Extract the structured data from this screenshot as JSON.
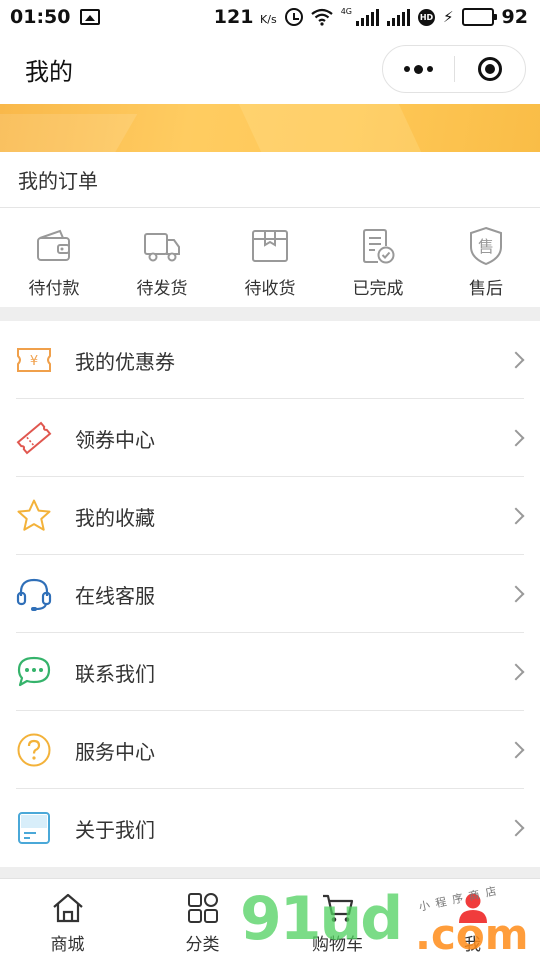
{
  "status_bar": {
    "time": "01:50",
    "net_speed": "121",
    "net_speed_unit": "K/s",
    "network_type": "4G",
    "battery_level": "92",
    "battery_fraction": 0.92,
    "icons": [
      "gallery-icon",
      "alarm-icon",
      "wifi-icon",
      "signal-icon",
      "hd-icon",
      "charging-icon",
      "battery-icon"
    ]
  },
  "header": {
    "title": "我的"
  },
  "orders": {
    "title": "我的订单",
    "items": [
      {
        "label": "待付款",
        "icon": "wallet-icon"
      },
      {
        "label": "待发货",
        "icon": "truck-icon"
      },
      {
        "label": "待收货",
        "icon": "package-icon"
      },
      {
        "label": "已完成",
        "icon": "completed-icon"
      },
      {
        "label": "售后",
        "icon": "after-sales-icon"
      }
    ]
  },
  "menu": {
    "items": [
      {
        "label": "我的优惠券",
        "icon": "coupon-icon",
        "color": "#f0a04b"
      },
      {
        "label": "领券中心",
        "icon": "ticket-icon",
        "color": "#e0574f"
      },
      {
        "label": "我的收藏",
        "icon": "star-icon",
        "color": "#f3b23a"
      },
      {
        "label": "在线客服",
        "icon": "headset-icon",
        "color": "#2f6fb8"
      },
      {
        "label": "联系我们",
        "icon": "chat-icon",
        "color": "#35b36b"
      },
      {
        "label": "服务中心",
        "icon": "question-icon",
        "color": "#f3b23a"
      },
      {
        "label": "关于我们",
        "icon": "card-icon",
        "color": "#4aa8d8"
      }
    ]
  },
  "tabbar": {
    "items": [
      {
        "label": "商城",
        "icon": "home-icon"
      },
      {
        "label": "分类",
        "icon": "category-icon"
      },
      {
        "label": "购物车",
        "icon": "cart-icon"
      },
      {
        "label": "我",
        "icon": "user-icon",
        "active": true
      }
    ],
    "active_color": "#f03c3c"
  },
  "watermark": {
    "main": "91ud",
    "suffix": ".com",
    "tagline": "小程序商店"
  }
}
